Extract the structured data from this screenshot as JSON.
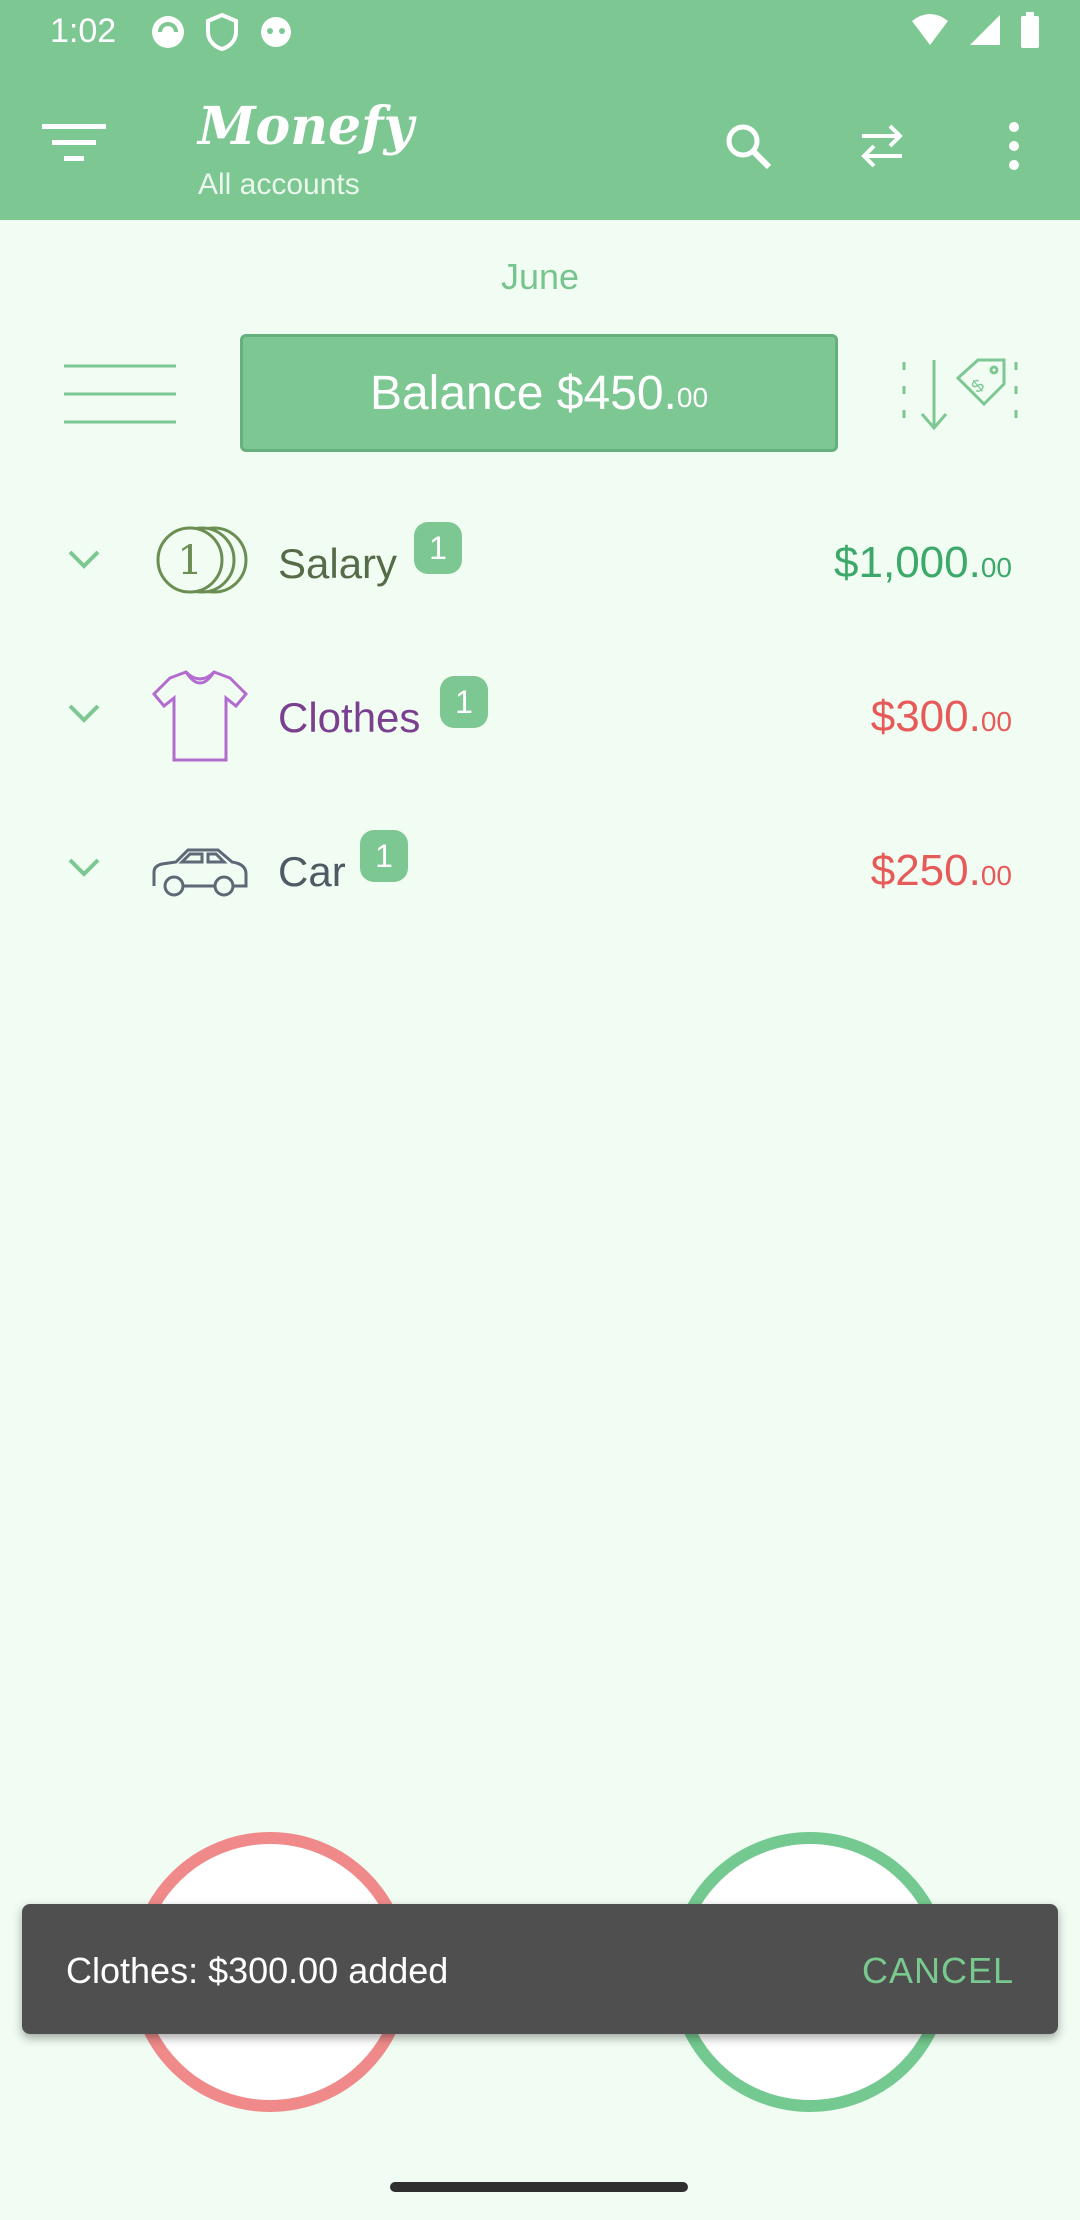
{
  "status_bar": {
    "time": "1:02",
    "notification_icons": [
      "sync-icon",
      "shield-icon",
      "android-icon"
    ],
    "system_icons": [
      "wifi-icon",
      "signal-icon",
      "battery-icon"
    ]
  },
  "app_bar": {
    "title": "Monefy",
    "subtitle": "All accounts",
    "actions": [
      "search-icon",
      "transfer-icon",
      "more-vert-icon"
    ]
  },
  "period": {
    "label": "June"
  },
  "balance": {
    "main": "Balance $450.",
    "cents": "00"
  },
  "categories": [
    {
      "name": "Salary",
      "count": "1",
      "amount_main": "$1,000.",
      "amount_cents": "00",
      "type": "income",
      "icon": "coins-icon"
    },
    {
      "name": "Clothes",
      "count": "1",
      "amount_main": "$300.",
      "amount_cents": "00",
      "type": "expense",
      "icon": "shirt-icon"
    },
    {
      "name": "Car",
      "count": "1",
      "amount_main": "$250.",
      "amount_cents": "00",
      "type": "expense",
      "icon": "car-icon"
    }
  ],
  "colors": {
    "primary": "#7DC793",
    "income": "#3CA86A",
    "expense": "#E65A5A",
    "background": "#F1FDF3",
    "salary_label": "#566B47",
    "clothes_label": "#7A3F8F",
    "car_label": "#505A64"
  },
  "snackbar": {
    "message": "Clothes: $300.00 added",
    "action": "CANCEL"
  }
}
